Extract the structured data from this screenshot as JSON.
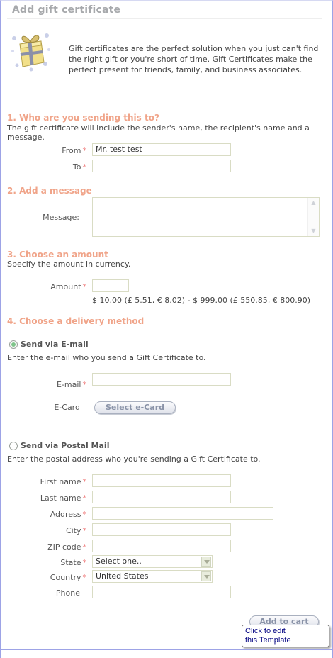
{
  "page": {
    "title": "Add gift certificate",
    "intro": "Gift certificates are the perfect solution when you just can't find the right gift or you're short of time. Gift Certificates make the perfect present for friends, family, and business associates."
  },
  "section1": {
    "title": "1. Who are you sending this to?",
    "desc": "The gift certificate will include the sender's name, the recipient's name and a message.",
    "from_label": "From",
    "from_value": "Mr. test test",
    "to_label": "To",
    "to_value": ""
  },
  "section2": {
    "title": "2. Add a message",
    "message_label": "Message:",
    "message_value": ""
  },
  "section3": {
    "title": "3. Choose an amount",
    "desc": "Specify the amount in currency.",
    "amount_label": "Amount",
    "amount_value": "",
    "range_text": "$ 10.00 (£ 5.51, € 8.02) - $ 999.00 (£ 550.85, € 800.90)"
  },
  "section4": {
    "title": "4. Choose a delivery method",
    "email_option": {
      "label": "Send via E-mail",
      "selected": true,
      "desc": "Enter the e-mail who you send a Gift Certificate to.",
      "email_label": "E-mail",
      "email_value": "",
      "ecard_label": "E-Card",
      "ecard_button": "Select e-Card"
    },
    "postal_option": {
      "label": "Send via Postal Mail",
      "selected": false,
      "desc": "Enter the postal address who you're sending a Gift Certificate to.",
      "first_name_label": "First name",
      "last_name_label": "Last name",
      "address_label": "Address",
      "city_label": "City",
      "zip_label": "ZIP code",
      "state_label": "State",
      "state_value": "Select one..",
      "country_label": "Country",
      "country_value": "United States",
      "phone_label": "Phone"
    }
  },
  "actions": {
    "add_to_cart": "Add to cart"
  },
  "tooltip": {
    "line1": "Click to edit",
    "line2": "this Template"
  },
  "colors": {
    "section_title": "#f0a489",
    "required_star": "#f08080",
    "frame_border": "#9da3e6",
    "tooltip_text": "#000080"
  },
  "icons": {
    "gift": "gift-box-icon"
  }
}
